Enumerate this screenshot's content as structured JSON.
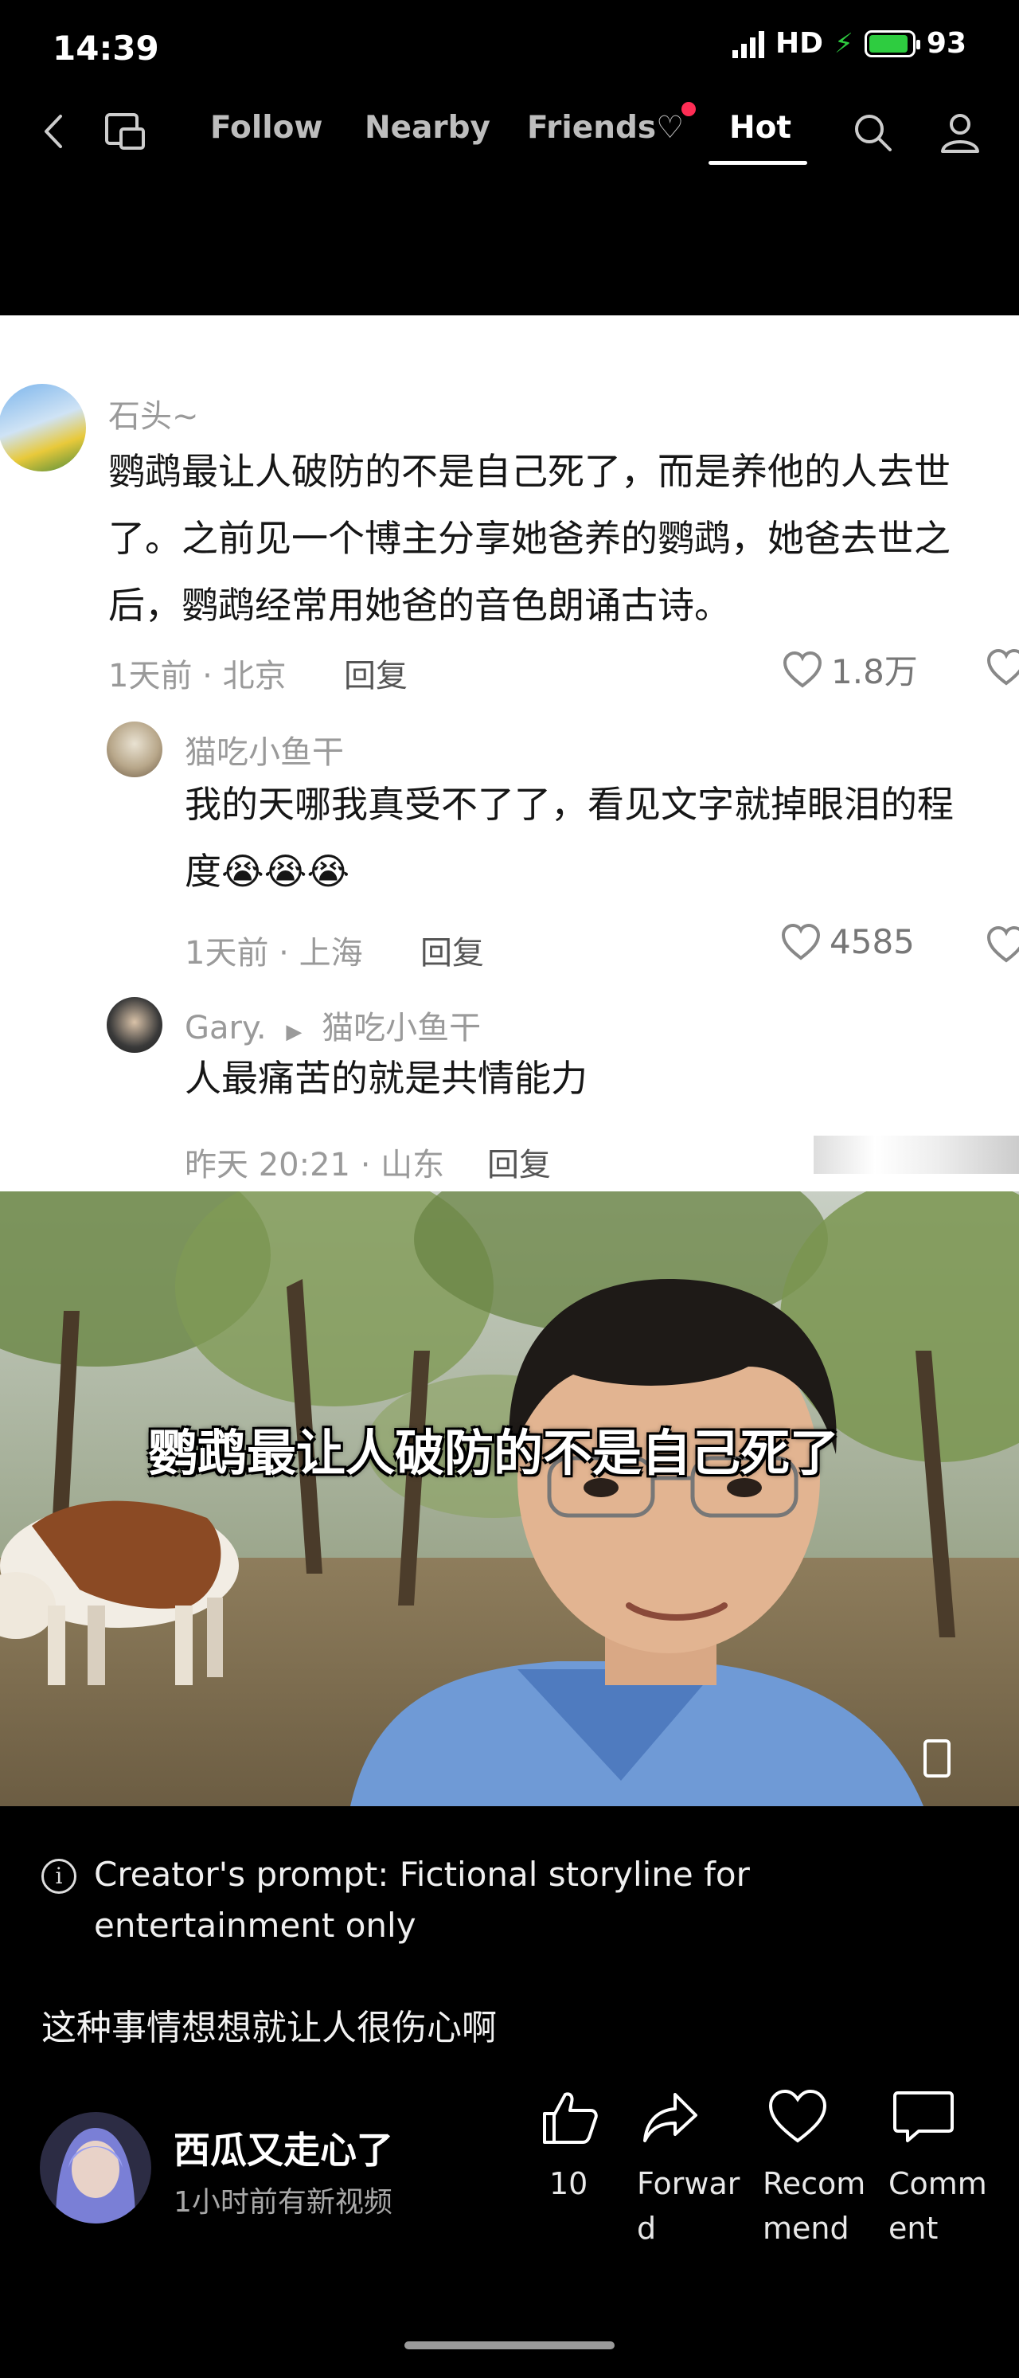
{
  "status": {
    "time": "14:39",
    "network": "HD",
    "battery": "93",
    "battery_level": 0.93
  },
  "nav": {
    "tabs": [
      {
        "label": "Follow"
      },
      {
        "label": "Nearby"
      },
      {
        "label": "Friends♡"
      },
      {
        "label": "Hot"
      }
    ],
    "active_tab": "Hot"
  },
  "comments": [
    {
      "user": "石头~",
      "lines": [
        "鹦鹉最让人破防的不是自己死了，而是养他的人去世",
        "了。之前见一个博主分享她爸养的鹦鹉，她爸去世之",
        "后，鹦鹉经常用她爸的音色朗诵古诗。"
      ],
      "meta": "1天前 · 北京",
      "reply": "回复",
      "likes": "1.8万"
    },
    {
      "user": "猫吃小鱼干",
      "lines": [
        "我的天哪我真受不了了，看见文字就掉眼泪的程",
        "度😭😭😭"
      ],
      "meta": "1天前 · 上海",
      "reply": "回复",
      "likes": "4585"
    },
    {
      "user": "Gary.",
      "reply_to": "猫吃小鱼干",
      "lines": [
        "人最痛苦的就是共情能力"
      ],
      "meta": "昨天 20:21 · 山东",
      "reply": "回复"
    }
  ],
  "subtitle": "鹦鹉最让人破防的不是自己死了",
  "notice": "Creator's prompt: Fictional storyline for entertainment only",
  "caption": "这种事情想想就让人很伤心啊",
  "author": {
    "name": "西瓜又走心了",
    "subtitle": "1小时前有新视频"
  },
  "actions": [
    {
      "label": "10",
      "icon": "thumbs-up-icon"
    },
    {
      "label": "Forward",
      "icon": "share-arrow-icon"
    },
    {
      "label": "Recommend",
      "icon": "heart-icon"
    },
    {
      "label": "Comment",
      "icon": "comment-bubble-icon"
    }
  ]
}
